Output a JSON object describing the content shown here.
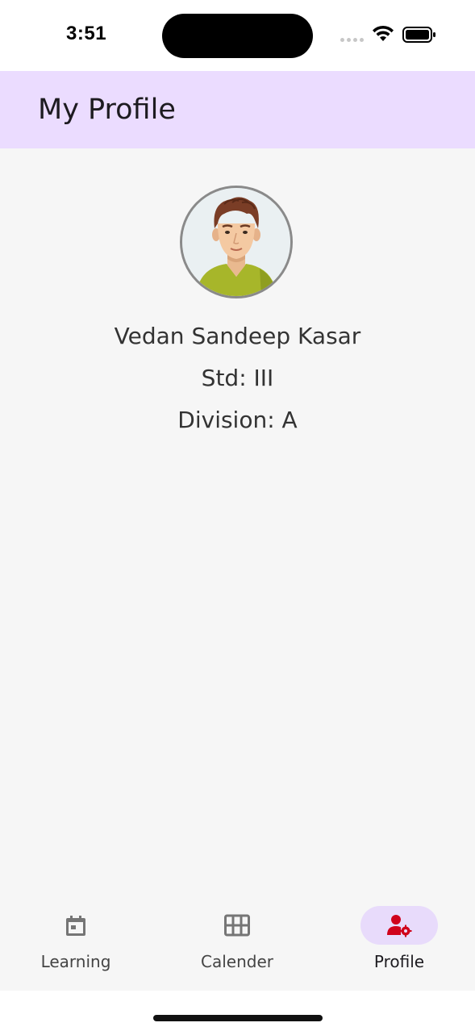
{
  "status_bar": {
    "time": "3:51",
    "icons": [
      "cellular-signal-icon",
      "wifi-icon",
      "battery-icon"
    ]
  },
  "header": {
    "title": "My Profile",
    "background": "#ebdcff"
  },
  "profile": {
    "avatar": "student-avatar",
    "name": "Vedan Sandeep Kasar",
    "std": "Std: III",
    "division": "Division: A"
  },
  "bottom_nav": {
    "items": [
      {
        "label": "Learning",
        "icon": "calendar-icon",
        "active": false
      },
      {
        "label": "Calender",
        "icon": "grid-icon",
        "active": false
      },
      {
        "label": "Profile",
        "icon": "user-settings-icon",
        "active": true
      }
    ],
    "active_color": "#d0021b",
    "active_pill": "#e8dbfb"
  }
}
